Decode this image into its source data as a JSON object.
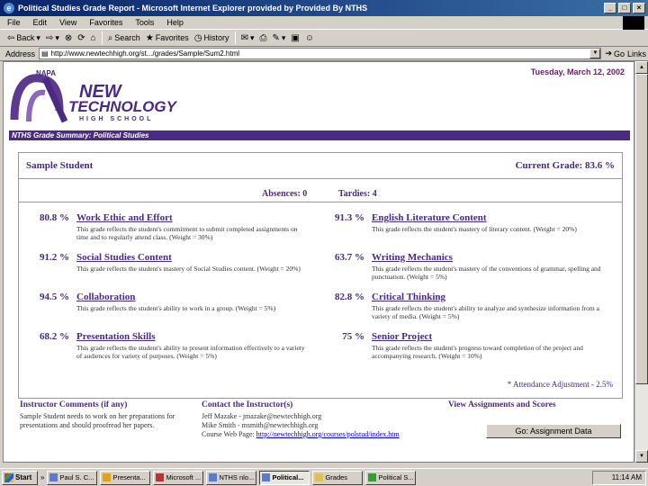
{
  "window": {
    "title": "Political Studies Grade Report - Microsoft Internet Explorer provided by Provided By NTHS"
  },
  "menu": [
    "File",
    "Edit",
    "View",
    "Favorites",
    "Tools",
    "Help"
  ],
  "toolbar": {
    "back": "Back",
    "search": "Search",
    "favorites": "Favorites",
    "history": "History"
  },
  "address": {
    "label": "Address",
    "url": "http://www.newtechhigh.org/st.../grades/Sample/Sum2.html",
    "go": "Go",
    "links": "Links"
  },
  "page": {
    "date": "Tuesday, March 12, 2002",
    "logo": {
      "napa": "NAPA",
      "line1": "NEW",
      "line2": "TECHNOLOGY",
      "line3": "HIGH SCHOOL"
    },
    "banner": "NTHS Grade Summary: Political Studies",
    "student": "Sample Student",
    "current_grade": "Current Grade: 83.6 %",
    "absences": "Absences: 0",
    "tardies": "Tardies: 4",
    "categories": [
      {
        "pct": "80.8 %",
        "name": "Work Ethic and Effort",
        "desc": "This grade reflects the student's commitment to submit completed assignments on time and to regularly attend class. (Weight = 30%)"
      },
      {
        "pct": "91.3 %",
        "name": "English Literature Content",
        "desc": "This grade reflects the student's mastery of literary content. (Weight = 20%)"
      },
      {
        "pct": "91.2 %",
        "name": "Social Studies Content",
        "desc": "This grade reflects the student's mastery of Social Studies content. (Weight = 20%)"
      },
      {
        "pct": "63.7 %",
        "name": "Writing Mechanics",
        "desc": "This grade reflects the student's mastery of the conventions of grammar, spelling and punctuation. (Weight = 5%)"
      },
      {
        "pct": "94.5 %",
        "name": "Collaboration",
        "desc": "This grade reflects the student's ability to work in a group. (Weight = 5%)"
      },
      {
        "pct": "82.8 %",
        "name": "Critical Thinking",
        "desc": "This grade reflects the student's ability to analyze and synthesize information from a variety of media. (Weight = 5%)"
      },
      {
        "pct": "68.2 %",
        "name": "Presentation Skills",
        "desc": "This grade reflects the student's ability to present information effectively to a variety of audiences for variety of purposes. (Weight = 5%)"
      },
      {
        "pct": "75 %",
        "name": "Senior Project",
        "desc": "This grade reflects the student's progress toward completion of the project and accompanying research. (Weight = 10%)"
      }
    ],
    "adjustment": "* Attendance Adjustment - 2.5%",
    "instructor_comments": {
      "title": "Instructor Comments (if any)",
      "text": "Sample Student needs to work on her preparations for presentations and should proofread her papers."
    },
    "contact": {
      "title": "Contact the Instructor(s)",
      "line1": "Jeff Mazake - jmazake@newtechhigh.org",
      "line2": "Mike Smith - msmith@newtechhigh.org",
      "web_label": "Course Web Page:",
      "web_url": "http://newtechhigh.org/courses/polstud/index.htm"
    },
    "view": {
      "title": "View Assignments and Scores",
      "button": "Go: Assignment Data"
    }
  },
  "taskbar": {
    "start": "Start",
    "tasks": [
      "Paul S. C...",
      "Presenta...",
      "Microsoft ...",
      "NTHS nlo...",
      "Political...",
      "Grades",
      "Political S..."
    ],
    "active_index": 4,
    "clock": "11:14 AM"
  }
}
